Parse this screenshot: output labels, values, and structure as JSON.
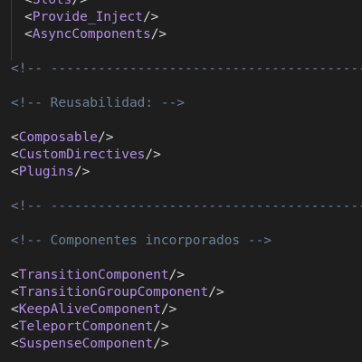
{
  "editor": {
    "colors": {
      "background": "#1e1e1e",
      "tag": "#b48ee8",
      "punctuation": "#d4d4d4",
      "comment": "#6a8096"
    },
    "lines": [
      {
        "kind": "tag",
        "indent": true,
        "open": "<",
        "name": "Slots",
        "close": "/>"
      },
      {
        "kind": "tag",
        "indent": true,
        "open": "<",
        "name": "Provide_Inject",
        "close": "/>"
      },
      {
        "kind": "tag",
        "indent": true,
        "open": "<",
        "name": "AsyncComponents",
        "close": "/>"
      },
      {
        "kind": "blank",
        "indent": true
      },
      {
        "kind": "comment",
        "text": "<!-- -------------------------------------------------------"
      },
      {
        "kind": "blank"
      },
      {
        "kind": "comment",
        "text": "<!-- Reusabilidad: -->"
      },
      {
        "kind": "blank"
      },
      {
        "kind": "tag",
        "open": "<",
        "name": "Composable",
        "close": "/>"
      },
      {
        "kind": "tag",
        "open": "<",
        "name": "CustomDirectives",
        "close": "/>"
      },
      {
        "kind": "tag",
        "open": "<",
        "name": "Plugins",
        "close": "/>"
      },
      {
        "kind": "blank"
      },
      {
        "kind": "comment",
        "text": "<!-- -------------------------------------------------------"
      },
      {
        "kind": "blank"
      },
      {
        "kind": "comment",
        "text": "<!-- Componentes incorporados -->"
      },
      {
        "kind": "blank"
      },
      {
        "kind": "tag",
        "open": "<",
        "name": "TransitionComponent",
        "close": "/>"
      },
      {
        "kind": "tag",
        "open": "<",
        "name": "TransitionGroupComponent",
        "close": "/>"
      },
      {
        "kind": "tag",
        "open": "<",
        "name": "KeepAliveComponent",
        "close": "/>"
      },
      {
        "kind": "tag",
        "open": "<",
        "name": "TeleportComponent",
        "close": "/>"
      },
      {
        "kind": "tag",
        "open": "<",
        "name": "SuspenseComponent",
        "close": "/>"
      }
    ]
  }
}
